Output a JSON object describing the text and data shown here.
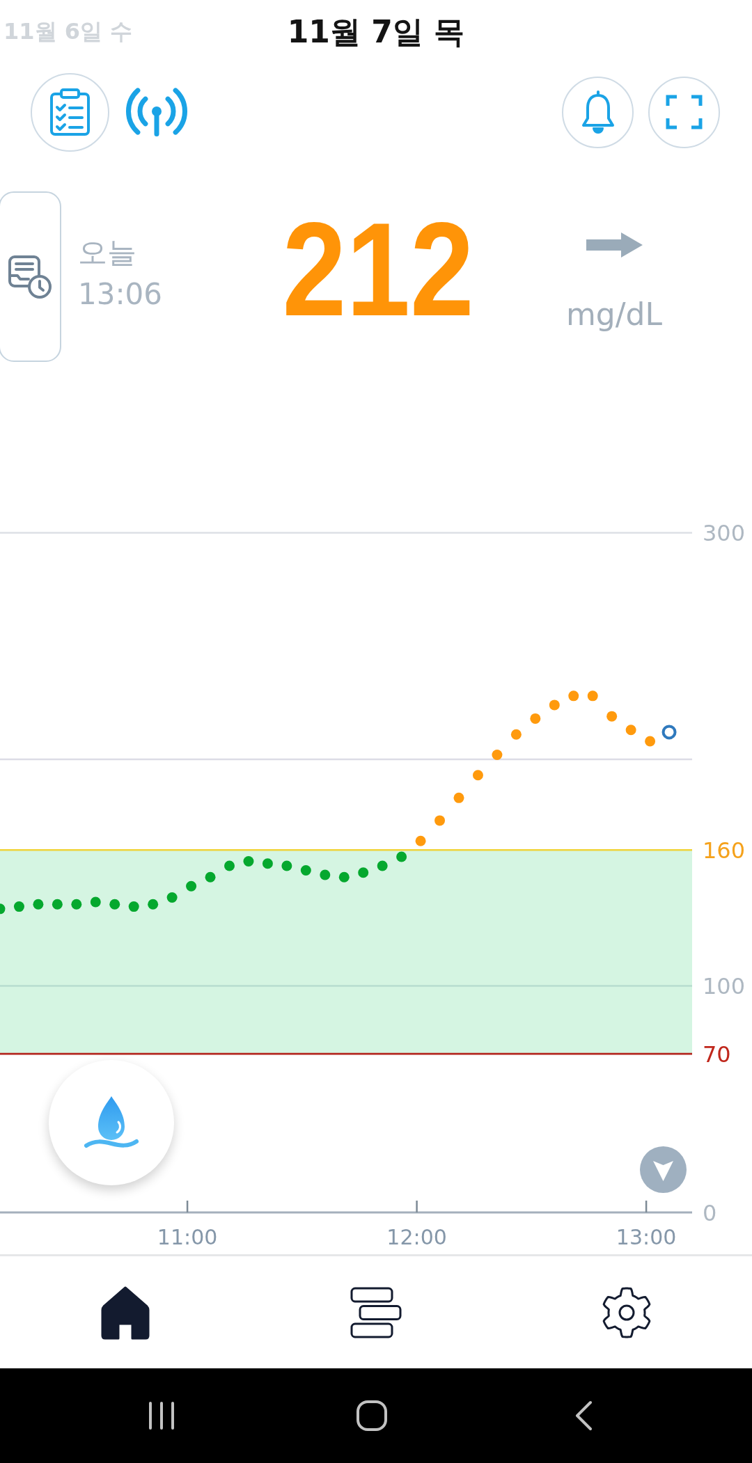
{
  "header": {
    "previous_day": "11월 6일 수",
    "title": "11월 7일 목",
    "sensor_connected": true
  },
  "reading": {
    "label": "오늘",
    "time": "13:06",
    "value": "212",
    "above_range": true,
    "unit": "mg/dL"
  },
  "chart": {
    "latest_marker_hollow": true,
    "chart_data": {
      "type": "scatter",
      "x": [
        611,
        616,
        621,
        626,
        631,
        636,
        641,
        646,
        651,
        656,
        661,
        666,
        671,
        676,
        681,
        686,
        691,
        696,
        701,
        706,
        711,
        716,
        721,
        726,
        731,
        736,
        741,
        746,
        751,
        756,
        761,
        766,
        771,
        776,
        781,
        786
      ],
      "series": [
        {
          "marker": "circle",
          "color": "#05a82e",
          "values": [
            134,
            135,
            136,
            136,
            136,
            137,
            136,
            135,
            136,
            139,
            144,
            148,
            153,
            155,
            154,
            153,
            151,
            149,
            148,
            150,
            153,
            157,
            null,
            null,
            null,
            null,
            null,
            null,
            null,
            null,
            null,
            null,
            null,
            null,
            null,
            null
          ]
        },
        {
          "marker": "circle",
          "color": "#ff9a0d",
          "values": [
            null,
            null,
            null,
            null,
            null,
            null,
            null,
            null,
            null,
            null,
            null,
            null,
            null,
            null,
            null,
            null,
            null,
            null,
            null,
            null,
            null,
            null,
            164,
            173,
            183,
            193,
            202,
            211,
            218,
            224,
            228,
            228,
            219,
            213,
            208,
            null
          ]
        },
        {
          "marker": "circle",
          "color": "#2f79bd",
          "values": [
            null,
            null,
            null,
            null,
            null,
            null,
            null,
            null,
            null,
            null,
            null,
            null,
            null,
            null,
            null,
            null,
            null,
            null,
            null,
            null,
            null,
            null,
            null,
            null,
            null,
            null,
            null,
            null,
            null,
            null,
            null,
            null,
            null,
            null,
            null,
            212
          ]
        }
      ],
      "xlim": [
        611,
        792
      ],
      "ylim": [
        0,
        300
      ],
      "xticks": [
        {
          "value": 660,
          "label": "11:00"
        },
        {
          "value": 720,
          "label": "12:00"
        },
        {
          "value": 780,
          "label": "13:00"
        }
      ],
      "yticks": [
        {
          "value": 0,
          "label": "0"
        },
        {
          "value": 70,
          "label": "70"
        },
        {
          "value": 100,
          "label": "100"
        },
        {
          "value": 160,
          "label": "160"
        },
        {
          "value": 300,
          "label": "300"
        }
      ],
      "bands": [
        {
          "axis": "y",
          "from": 70,
          "to": 160,
          "color": "#d5f5e2"
        }
      ],
      "ref_lines": [
        {
          "axis": "y",
          "value": 300,
          "color": "#dde0e6"
        },
        {
          "axis": "y",
          "value": 200,
          "color": "#dcdce6"
        },
        {
          "axis": "y",
          "value": 160,
          "color": "#f0d43a"
        },
        {
          "axis": "y",
          "value": 100,
          "color": "#b7dccf"
        },
        {
          "axis": "y",
          "value": 70,
          "color": "#b3261e"
        }
      ]
    }
  },
  "nav": {
    "items": [
      {
        "selected": true
      },
      {
        "selected": false
      },
      {
        "selected": false
      }
    ]
  }
}
